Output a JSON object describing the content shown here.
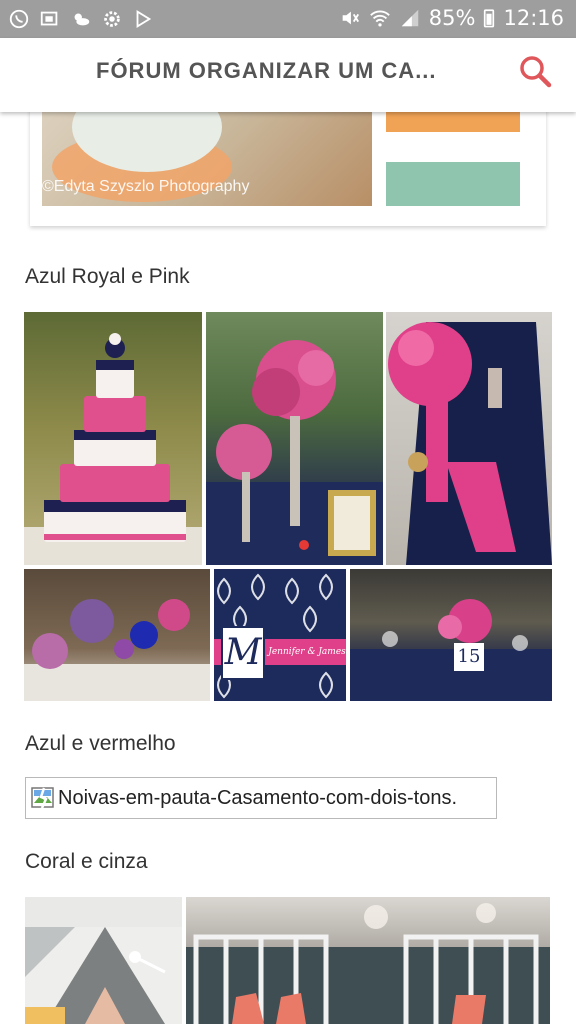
{
  "status_bar": {
    "battery": "85%",
    "time": "12:16"
  },
  "app_bar": {
    "title": "FÓRUM ORGANIZAR UM CA..."
  },
  "previous_card": {
    "watermark": "©Edyta Szyszlo Photography"
  },
  "sections": [
    {
      "title": "Azul Royal e Pink"
    },
    {
      "title": "Azul e vermelho",
      "broken_image_alt": "Noivas-em-pauta-Casamento-com-dois-tons."
    },
    {
      "title": "Coral e cinza"
    }
  ],
  "monogram": {
    "letter": "M",
    "names": "Jennifer & James"
  },
  "table_number": "15",
  "colors": {
    "accent": "#e53935",
    "navy": "#1d2a5c",
    "pink": "#e0408a",
    "coral": "#e97a68"
  }
}
